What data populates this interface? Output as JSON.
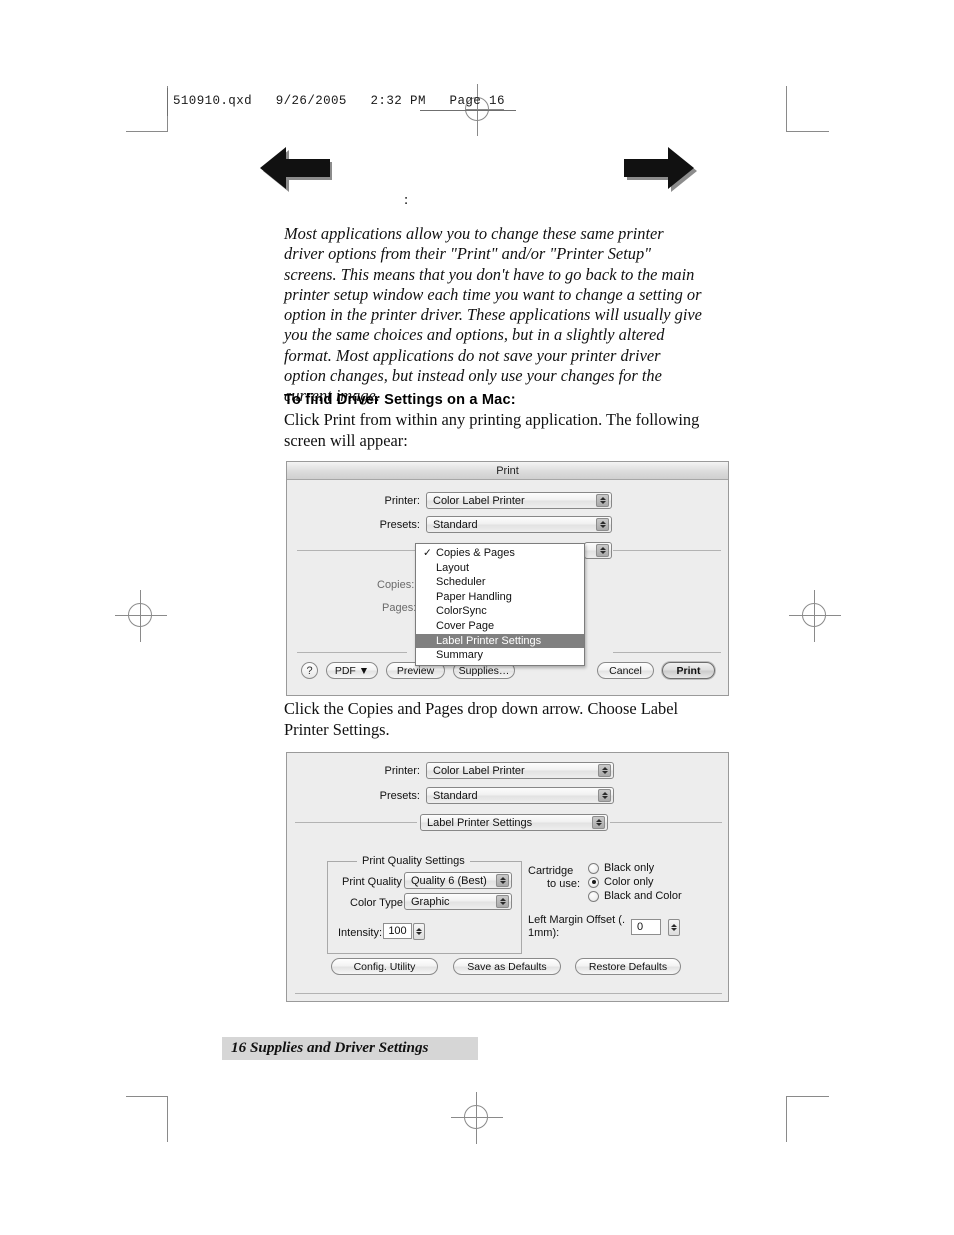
{
  "page": {
    "slug": "510910.qxd   9/26/2005   2:32 PM   Page 16",
    "stray_mark": ":",
    "footer": "16  Supplies and Driver Settings"
  },
  "nav": {
    "back_arrow": "left-arrow",
    "forward_arrow": "right-arrow"
  },
  "content": {
    "intro_italic": "Most applications allow you to change these same printer driver options from their \"Print\" and/or \"Printer Setup\" screens. This means that you don't have to go back to the main printer setup window each time you want to change a setting or option in the printer driver. These applications will usually give you the same choices and options, but in a slightly altered format. Most applications do not save your printer driver option changes, but instead only use your changes for the current image.",
    "section_heading": "To find Driver Settings on a Mac:",
    "paragraph_1": "Click Print from within any printing application.  The following screen will appear:",
    "paragraph_2": "Click the Copies and Pages drop down arrow.  Choose Label Printer Settings."
  },
  "dialog1": {
    "title": "Print",
    "labels": {
      "printer": "Printer:",
      "presets": "Presets:",
      "copies": "Copies:",
      "pages": "Pages:"
    },
    "printer_value": "Color Label Printer",
    "presets_value": "Standard",
    "menu": {
      "items": [
        {
          "label": "Copies & Pages",
          "checked": true,
          "selected": false
        },
        {
          "label": "Layout",
          "checked": false,
          "selected": false
        },
        {
          "label": "Scheduler",
          "checked": false,
          "selected": false
        },
        {
          "label": "Paper Handling",
          "checked": false,
          "selected": false
        },
        {
          "label": "ColorSync",
          "checked": false,
          "selected": false
        },
        {
          "label": "Cover Page",
          "checked": false,
          "selected": false
        },
        {
          "label": "Label Printer Settings",
          "checked": false,
          "selected": true
        },
        {
          "label": "Summary",
          "checked": false,
          "selected": false
        }
      ],
      "check_glyph": "✓"
    },
    "buttons": {
      "help": "?",
      "pdf": "PDF ▼",
      "preview": "Preview",
      "supplies": "Supplies…",
      "cancel": "Cancel",
      "print": "Print"
    }
  },
  "dialog2": {
    "labels": {
      "printer": "Printer:",
      "presets": "Presets:"
    },
    "printer_value": "Color Label Printer",
    "presets_value": "Standard",
    "pane_value": "Label Printer Settings",
    "quality_group": {
      "title": "Print Quality Settings",
      "print_quality_label": "Print Quality",
      "print_quality_value": "Quality 6 (Best)",
      "color_type_label": "Color Type",
      "color_type_value": "Graphic",
      "intensity_label": "Intensity:",
      "intensity_value": "100"
    },
    "cartridge": {
      "label_line1": "Cartridge",
      "label_line2": "to use:",
      "options": [
        {
          "label": "Black only",
          "selected": false
        },
        {
          "label": "Color only",
          "selected": true
        },
        {
          "label": "Black and Color",
          "selected": false
        }
      ]
    },
    "margin": {
      "label_line1": "Left Margin Offset (.",
      "label_line2": "1mm):",
      "value": "0"
    },
    "buttons": {
      "config": "Config. Utility",
      "save_defaults": "Save as Defaults",
      "restore_defaults": "Restore Defaults"
    }
  },
  "colors": {
    "dialog_bg": "#ededed",
    "menu_highlight": "#808080",
    "footer_band": "#d6d6d6",
    "crop_mark": "#8a8a8a"
  }
}
